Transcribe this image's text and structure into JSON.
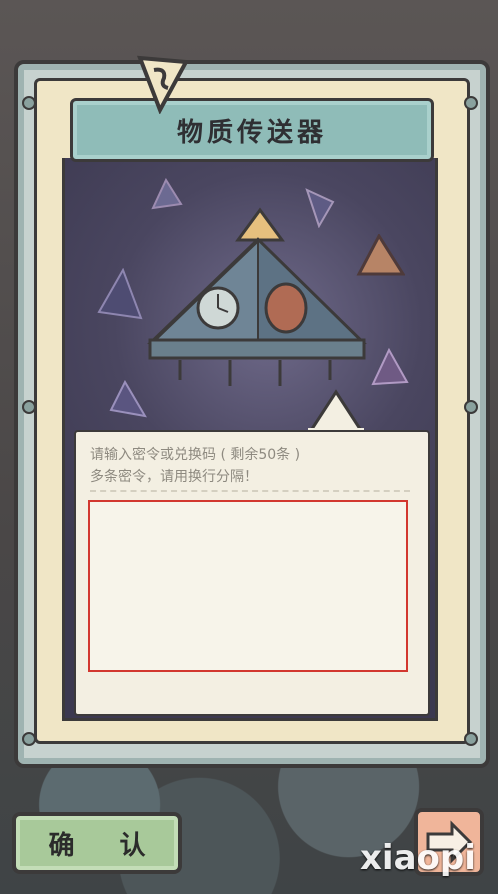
{
  "title": "物质传送器",
  "panel": {
    "hint_line1": "请输入密令或兑换码 ( 剩余50条 )",
    "hint_line2": "多条密令，请用换行分隔！",
    "input_value": ""
  },
  "buttons": {
    "confirm_label": "确 认",
    "next_icon": "arrow-right-icon"
  },
  "watermark": "xiaopi",
  "colors": {
    "banner": "#8fbcb8",
    "input_border": "#d2372f",
    "confirm": "#a8c99a",
    "next": "#f0b59a"
  }
}
